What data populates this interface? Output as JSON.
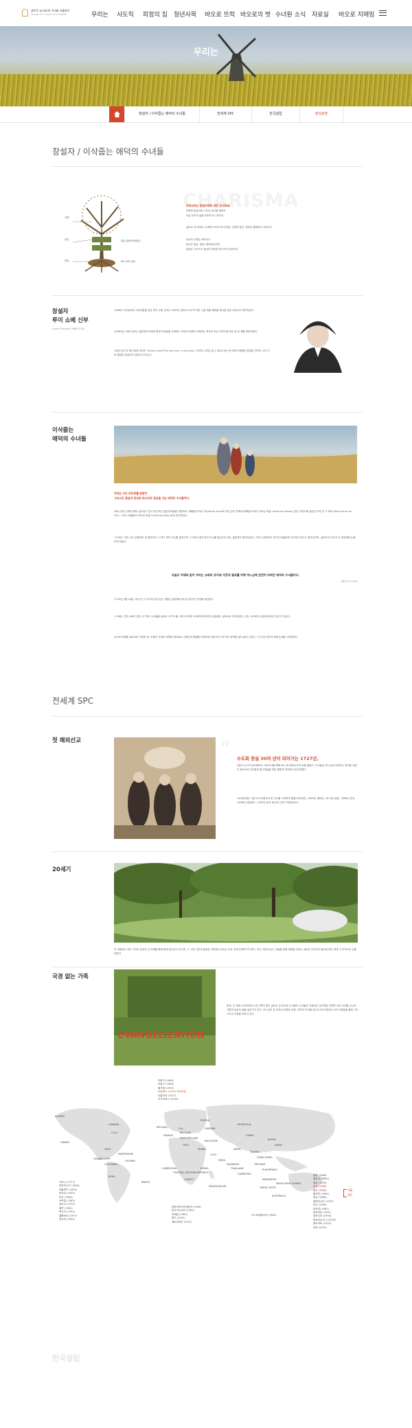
{
  "nav": {
    "logo_line1": "샬트르 성 바오로 수녀회 서울관구",
    "logo_line2": "SISTERS OF ST.PAUL OF CHARTRES",
    "items": [
      "우리는",
      "사도직",
      "피정의 집",
      "청년사목",
      "바오로 뜨락",
      "바오로의 벗",
      "수녀원 소식",
      "자료실",
      "바오로 지에밍"
    ]
  },
  "hero": {
    "title": "우리는"
  },
  "tabs": {
    "items": [
      "창설자 / 이삭줍는 애덕의 수녀들",
      "전세계 SPC",
      "한국설립",
      "영성표방"
    ]
  },
  "section1": {
    "title": "창설자 / 이삭줍는 애덕의 수녀들"
  },
  "charisma": {
    "watermark": "CHARISMA",
    "lead1": "카리스마는 창설자에게 내린 은사로써,",
    "lead2": "과목한 일상이며 시간과 공간을 헤쳐서",
    "lead3": "오늘 우리의 삶을 비추어주는 빛이다.",
    "p2": "샬트르 성 바오로 수녀회의 카리스마 안에는 사명과 정신, 영성이 통합되어 나타난다.",
    "p3a": "우리의 사명은 애덕이고",
    "p3b": "정신은 겸손, 절제, 애덕정신이며,",
    "p3c": "영성은 그리스도 중심의 영성과 파스카의 영성이다.",
    "tree_labels": [
      "사명",
      "정신",
      "영성",
      "덕",
      "그리스도 중심의 영성",
      "파스카의 영성",
      "겸손·절제·애덕정신"
    ]
  },
  "founder": {
    "title1": "창설자",
    "title2": "루이 쇼베 신부",
    "sub": "(Louis Chauvet, 1664-1710)",
    "p1": "1688년 아이농에서 사제서품을 받은 루이 쇼베 신부는 1694년 샬트르 교구의 작은 시골 마을 레베빌 레샤넬 본당 주임으로 파견되었다.",
    "p2": "16983년, 쇼베 신부는 공동체의 모범과 함께 어린들을 교육하는 학교로 비참에 교육하는 학교로 본당 가까이에 작은 집 한 채를 마련하였다.",
    "p3": "사제관 입구의 해시계에 새겨진 'Ultima Latet(The last hour is unknown, 마지막 시간은 알 수 없다)'라는 문구에서 명확한 영성을 '마지막 시간'으로 응답한 창설자의 영성이 드러난다."
  },
  "sisters": {
    "title1": "이삭줍는",
    "title2": "애덕의 수녀들",
    "red1": "우리는 사도 바오로를 본받아",
    "red2": "그리스도 중심의 영성과 파스카의 영성을 사는 애덕의 수녀들이다.",
    "p1": "쇼베 신부는 함께 일해 나갈 동기 있고 헌신적인 젊은처녀들을 규합하여, 레베빌의 마리 아누Marie Anne와 작은 촌의 루에네 레베빌의 마리 카트린 바셀 Catherine Bassel, 본당 가까이에 살았던 마리 안 드 띠리 Marie Anne de Tilly, 그리고 레볼빌의 카트린 바셀 Catherine Baily 등이 파견되었다.",
    "p2": "1700년, 작은 수도 공동체의 첫 봉헌으로 17세기 마리 아누를 맡았으며, 1708년 결국 마리 아누를 중심으로 하는 공동체가 형성되었다. 그리고 공동체의 기도와 이들에게 사도직의 장소가 생겨났으며, 샬트르의 주교가 이 공동체에 눈을 뜨게 되었다.",
    "quote": "오늘도 어제와 같이 우리는 교회의 유익과 이웃의 필요를 위해 하느님께 온전히 바쳐진 애덕의 수녀들이다.",
    "quote_by": "- 마리 안 드 티이",
    "p3": "1700년 9월 28일, 마리 안 드 티이의 갑작스런 서원은 공동체에 하나된 마지막 선의를 대변한다.",
    "p4": "1708년, 루이 쇼베 신부는 이 학교 수녀들을 샬트르 교구의 폴 고데 데 마레 주교에게 위탁하여 공동체는 샬트르로 이전하였다. 이는 수도회의 성장에 중요한 계기가 되었다.",
    "p5": "수도회 모원을 샬트르로 이전한 후, 모원지 극생의 대축제 제도화로 수행인과 병원을 운영하게 되었으며 사도직의 영역을 점차 넓혀 나갔다. 1727년 최초의 해외선교를 시작하였다."
  },
  "world": {
    "title": "전세계 SPC"
  },
  "mission": {
    "title": "첫 해외선교",
    "red": "수도회 창설 30여 년이 되어가는 1727년,",
    "p1": "4명의 수녀가 남아메리카 가이아나를 향해 떠나 첫 해외선교의 문을 열었다. 수녀들은 하느님께 의탁하는 정직한 대답이 됨으로써 군인들과 원주민들을 위한 병원과 학교에서 헌신하였다.",
    "p2": "1848년에는 극동 아시아에서의 첫 선교를 시작하여 홍콩(1848년), 1860년 베트남, 1878년 일본, 1888년 한국, 1898년 타일랜드, 1909년 중국 등으로 선교가 확장되었다."
  },
  "century": {
    "title": "20세기",
    "p1": "전 세계에서 여러 가지의 분야의 전 교회를 향해 함께 헌신하고 있으며, 그 시대 가운데 필요한 자리에서 우리는 모든 곳에 존재하고자 한다. 빈민 가운데 있는 이들을 위해 복음을 전하는 새로운 선교지의 필요에 따라 세계 각 지역으로 진출하였다.",
    "ep": "EVANGELIZATION"
  },
  "family": {
    "title": "국경 없는 가족",
    "p1": "현재, 전 세계 40개국에서 4천 3백여 명의 샬트르 성 바오로 수녀회의 수녀들은 국제적인 대가족을 이루며 서로 친교를 나누며 기쁨과 공유의 삶을 살아가고 있다. 하느님의 뜻 안에서 문화와 인종, 지역의 차이를 넘어서 여러 형태의 사도직 활동을 통해 그리스도의 사랑을 전하고 있다."
  },
  "map": {
    "top_list": [
      "포항가 (1696)",
      "프랑스 (1696)",
      "벨기에 (1904)",
      "아일랜드 (1930) 포르투갈",
      "이탈리아 (1972)",
      "우크라이나 (2003)"
    ],
    "left_list": [
      "기아나 (1727)",
      "마르티니크 (1818)",
      "과들루프 (1820)",
      "하이티 (1930)",
      "미국 (1963)",
      "브라질 (1963)",
      "캐나다 (1972)",
      "페루 (1981)",
      "멕시코 (1994)",
      "콜롬비아 (1997)",
      "하이티 (2005)"
    ],
    "bottom_list": [
      "중앙아프리카공화국 (1946)",
      "마다가스카르 (1950)",
      "카메룬 (1962)",
      "콩고 (2015)",
      "에티오피아 (2012)"
    ],
    "aus_label": "오스트레일리아 (1984)",
    "right_list": [
      "홍콩 (1848)",
      "베트남 (1860)",
      "일본 (1878)",
      "한국 (1888)",
      "중국 (1909)",
      "필리핀 (1904)",
      "태국 (1898)",
      "말레이시아 (1937)",
      "인도 (1956)",
      "미얀마 (1981)",
      "동티모르 (1991)",
      "캄보디아 (1994)",
      "파푸아뉴기니 (2016)",
      "동티모르 (2014)",
      "이란 (2015)"
    ],
    "korea_labels": [
      "서울",
      "대구"
    ],
    "cities": [
      "ALASKA",
      "CANADA",
      "U.S.A",
      "HAWAII",
      "HAITI",
      "MARTINIQUE",
      "GUADELOUPE",
      "GUYANA",
      "COLOMBIA",
      "PERU",
      "BRAZIL",
      "IRELAND",
      "U.K.",
      "FRANCE",
      "SWITZERLAND",
      "ITALY",
      "BELGIUM",
      "RUSSIA",
      "UKRAINE",
      "PALESTINE",
      "ISRAEL",
      "U.A.E.",
      "INDIA",
      "NEPAL",
      "MYANMAR",
      "MONGOLIA",
      "CHINA",
      "KOREA",
      "JAPAN",
      "TAIWAN",
      "HONG KONG",
      "VIETNAM",
      "THAILAND",
      "PHILIPPINES",
      "CAMBODIA",
      "INDONESIA",
      "TIMOR LESTE",
      "PAPUA NEW GUINEA",
      "AUSTRALIA",
      "CAMEROON",
      "CENTRAL AFRICAN REPUBLIC",
      "CONGO",
      "MADAGASCAR",
      "KENYA"
    ]
  },
  "korea": {
    "title": "한국설립"
  },
  "colors": {
    "accent": "#d4472a",
    "gold": "#c9a05c",
    "line": "#e4e4e4"
  },
  "icons": {
    "home": "home-icon",
    "menu": "hamburger-menu-icon"
  }
}
